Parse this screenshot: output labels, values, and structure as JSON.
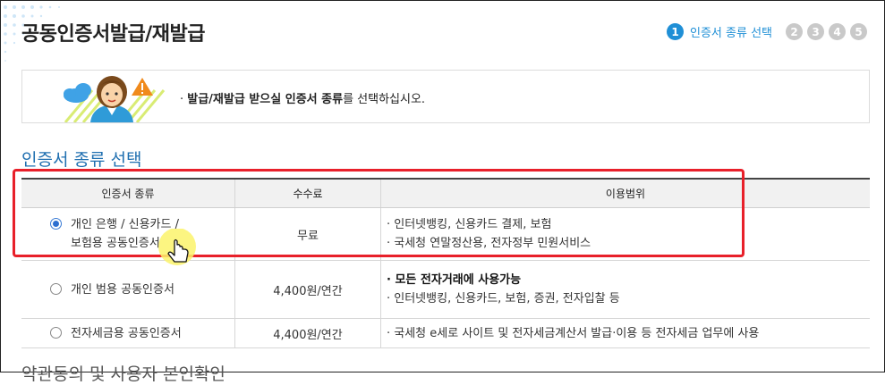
{
  "page": {
    "title": "공동인증서발급/재발급"
  },
  "steps": {
    "active_number": "1",
    "active_label": "인증서 종류 선택",
    "others": [
      "2",
      "3",
      "4",
      "5"
    ]
  },
  "notice": {
    "text_bold": "발급/재발급 받으실 인증서 종류",
    "text_rest": "를 선택하십시오.",
    "icons": [
      "cloud-icon",
      "warning-icon",
      "person-illustration"
    ]
  },
  "section": {
    "title": "인증서 종류 선택"
  },
  "table": {
    "headers": [
      "인증서 종류",
      "수수료",
      "이용범위"
    ],
    "rows": [
      {
        "type_line1": "개인 은행 / 신용카드 /",
        "type_line2": "보험용 공동인증서",
        "checked": true,
        "fee": "무료",
        "usage": [
          "인터넷뱅킹, 신용카드 결제, 보험",
          "국세청 연말정산용, 전자정부 민원서비스"
        ]
      },
      {
        "type_line1": "개인 범용 공동인증서",
        "checked": false,
        "fee": "4,400원/연간",
        "usage_bold": "모든 전자거래에 사용가능",
        "usage": [
          "인터넷뱅킹, 신용카드, 보험, 증권, 전자입찰 등"
        ]
      },
      {
        "type_line1": "전자세금용 공동인증서",
        "checked": false,
        "fee": "4,400원/연간",
        "usage": [
          "국세청 e세로 사이트 및 전자세금계산서 발급·이용 등 전자세금 업무에 사용"
        ]
      }
    ]
  },
  "bottom_section": {
    "title": "약관동의 및 사용자 본인확인"
  },
  "colors": {
    "accent": "#1f8fd6",
    "highlight_border": "#e8202a",
    "link_blue": "#1f6fb0"
  }
}
